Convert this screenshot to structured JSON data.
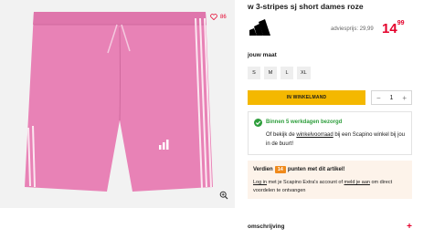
{
  "product": {
    "title": "w 3-stripes sj short dames roze",
    "brand_logo": "adidas-logo",
    "advice_price": "adviesprijs: 29,99",
    "price_main": "14",
    "price_cents": "99",
    "wishlist_count": "86"
  },
  "size_section": {
    "label": "jouw maat",
    "options": [
      "S",
      "M",
      "L",
      "XL"
    ]
  },
  "cart": {
    "button_label": "IN WINKELMAND",
    "quantity": "1",
    "minus": "−",
    "plus": "+"
  },
  "delivery": {
    "title": "Binnen 5 werkdagen bezorgd",
    "text_before": "Of bekijk de ",
    "link": "winkelvoorraad",
    "text_after": " bij een Scapino winkel bij jou in de buurt!"
  },
  "points": {
    "prefix": "Verdien",
    "count": "14",
    "suffix": "punten met dit artikel!",
    "login_link": "Log in",
    "text_mid": " met je Scapino Extra's account of ",
    "signup_link": "meld je aan",
    "text_end": " om direct voordelen te ontvangen"
  },
  "description": {
    "label": "omschrijving",
    "expand": "+"
  },
  "colors": {
    "accent_red": "#e4002b",
    "cart_yellow": "#f4b800",
    "success_green": "#2e9e3c",
    "points_orange": "#f08a1c",
    "short_pink": "#e882b6"
  }
}
